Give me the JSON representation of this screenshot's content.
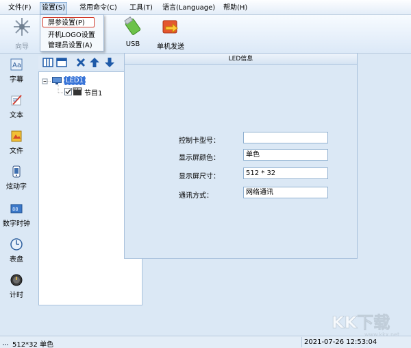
{
  "menu": {
    "file": "文件(F)",
    "settings": "设置(S)",
    "commands": "常用命令(C)",
    "tools": "工具(T)",
    "language": "语言(Language)",
    "help": "帮助(H)"
  },
  "dropdown": {
    "screen_params": "屏参设置(P)",
    "boot_logo": "开机LOGO设置",
    "admin": "管理员设置(A)"
  },
  "toolbar": {
    "wizard": "向导",
    "usb": "USB",
    "send": "单机发送"
  },
  "leftbar": {
    "subtitle": "字幕",
    "text": "文本",
    "file": "文件",
    "animated": "炫动字",
    "digital_clock": "数字时钟",
    "dial": "表盘",
    "timer": "计时"
  },
  "tree": {
    "root": "LED1",
    "child": "节目1"
  },
  "led_panel": {
    "title": "LED信息",
    "fields": [
      {
        "label": "控制卡型号：",
        "value": ""
      },
      {
        "label": "显示屏颜色：",
        "value": "单色"
      },
      {
        "label": "显示屏尺寸：",
        "value": "512 * 32"
      },
      {
        "label": "通讯方式：",
        "value": "网络通讯"
      }
    ]
  },
  "status": {
    "screen_info": "512*32 单色",
    "datetime": "2021-07-26 12:53:04"
  },
  "watermark": {
    "text": "KK下载",
    "domain": "www.kkx.net"
  },
  "colors": {
    "highlight_border": "#d23a2a",
    "panel_bg": "#dbe8f5",
    "border": "#a9c1dc"
  }
}
